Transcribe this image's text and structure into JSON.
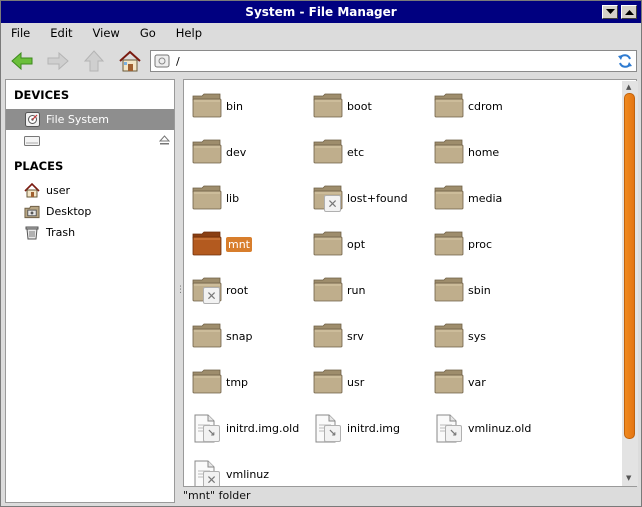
{
  "window": {
    "title": "System - File Manager"
  },
  "menu": {
    "file": "File",
    "edit": "Edit",
    "view": "View",
    "go": "Go",
    "help": "Help"
  },
  "toolbar": {
    "path": "/",
    "icons": [
      "back-arrow-icon",
      "forward-arrow-icon",
      "up-arrow-icon",
      "home-icon",
      "refresh-icon"
    ]
  },
  "sidebar": {
    "devices_heading": "DEVICES",
    "devices": [
      {
        "label": "File System",
        "icon": "harddisk-icon",
        "selected": true
      },
      {
        "label": "",
        "icon": "drive-icon",
        "eject": true
      }
    ],
    "places_heading": "PLACES",
    "places": [
      {
        "label": "user",
        "icon": "home-icon"
      },
      {
        "label": "Desktop",
        "icon": "desktop-icon"
      },
      {
        "label": "Trash",
        "icon": "trash-icon"
      }
    ]
  },
  "files": [
    {
      "name": "bin",
      "type": "folder"
    },
    {
      "name": "boot",
      "type": "folder"
    },
    {
      "name": "cdrom",
      "type": "folder"
    },
    {
      "name": "dev",
      "type": "folder"
    },
    {
      "name": "etc",
      "type": "folder"
    },
    {
      "name": "home",
      "type": "folder"
    },
    {
      "name": "lib",
      "type": "folder"
    },
    {
      "name": "lost+found",
      "type": "folder-locked"
    },
    {
      "name": "media",
      "type": "folder"
    },
    {
      "name": "mnt",
      "type": "folder",
      "selected": true
    },
    {
      "name": "opt",
      "type": "folder"
    },
    {
      "name": "proc",
      "type": "folder"
    },
    {
      "name": "root",
      "type": "folder-locked"
    },
    {
      "name": "run",
      "type": "folder"
    },
    {
      "name": "sbin",
      "type": "folder"
    },
    {
      "name": "snap",
      "type": "folder"
    },
    {
      "name": "srv",
      "type": "folder"
    },
    {
      "name": "sys",
      "type": "folder"
    },
    {
      "name": "tmp",
      "type": "folder"
    },
    {
      "name": "usr",
      "type": "folder"
    },
    {
      "name": "var",
      "type": "folder"
    },
    {
      "name": "initrd.img.old",
      "type": "link"
    },
    {
      "name": "initrd.img",
      "type": "link"
    },
    {
      "name": "vmlinuz.old",
      "type": "link"
    },
    {
      "name": "vmlinuz",
      "type": "link-broken"
    }
  ],
  "status": "\"mnt\" folder",
  "colors": {
    "titlebar": "#000080",
    "selection": "#d87e2c",
    "scroll_thumb": "#f08a1f",
    "folder": "#bfae8c"
  }
}
